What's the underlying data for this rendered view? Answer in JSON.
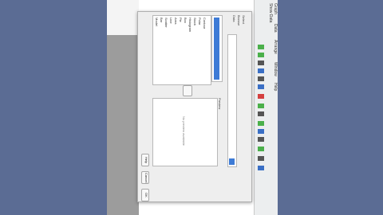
{
  "toolstrip": {
    "labels": [
      "Show Data",
      "Graph",
      "Data",
      "Arrange",
      "Window",
      "Help"
    ]
  },
  "dialog": {
    "header_labels": [
      "Select",
      "Browse",
      "Data"
    ],
    "list_items": [
      "Model",
      "Bar",
      "Scatter",
      "Line",
      "Area",
      "Pie",
      "Box",
      "Histogram",
      "Stock",
      "Polar",
      "Contour",
      "Surface"
    ],
    "panel_label": "Preview",
    "preview_placeholder": "No preview available",
    "buttons": {
      "help": "Help",
      "cancel": "Cancel",
      "ok": "OK"
    }
  }
}
